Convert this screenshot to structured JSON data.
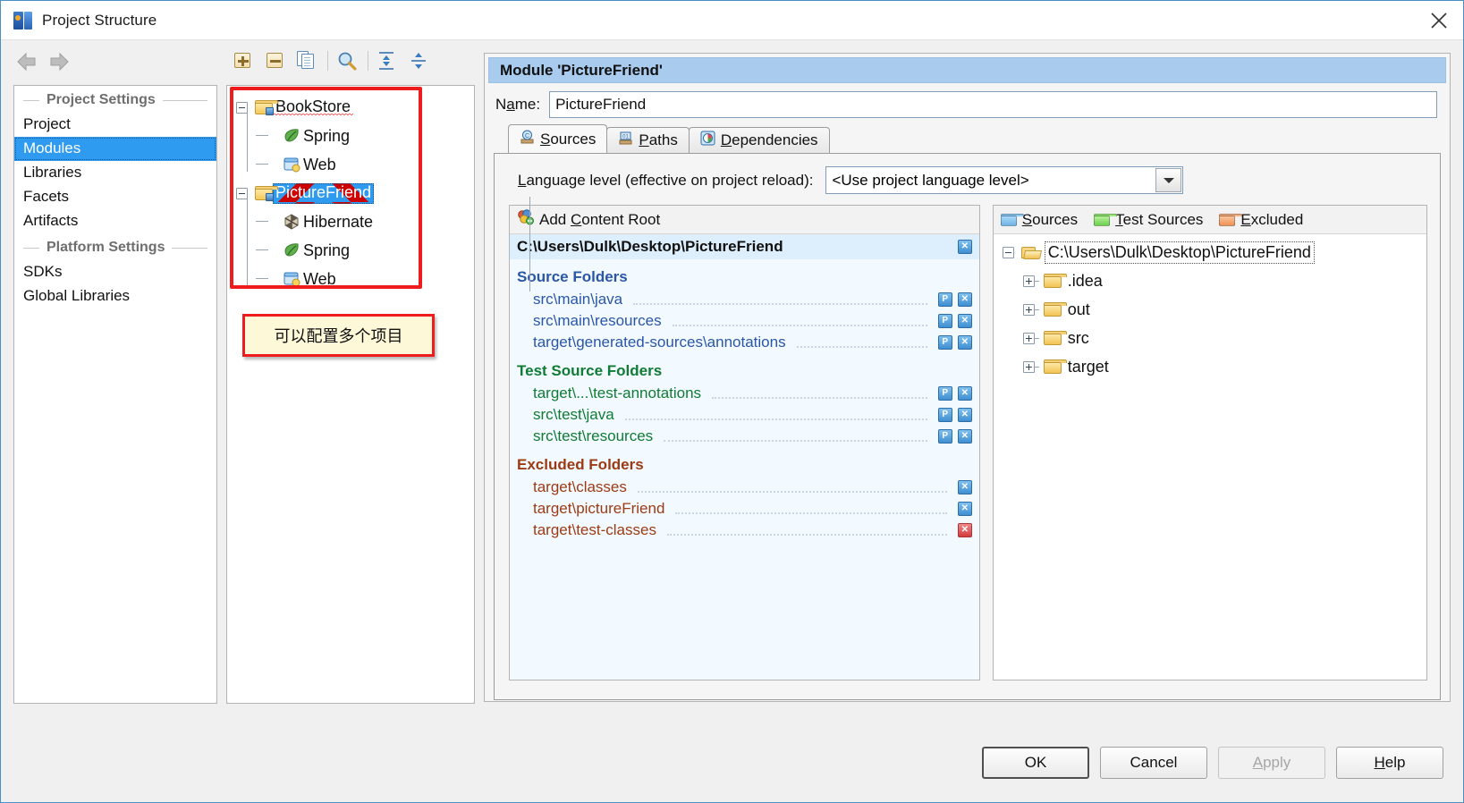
{
  "window": {
    "title": "Project Structure",
    "app_icon": "intellij-idea-icon",
    "close_icon": "close-icon"
  },
  "toolbar": {
    "back_icon": "arrow-left-icon",
    "forward_icon": "arrow-right-icon",
    "add_icon": "plus-icon",
    "remove_icon": "minus-icon",
    "copy_icon": "copy-icon",
    "find_icon": "search-icon",
    "expand_all_icon": "expand-all-icon",
    "collapse_all_icon": "collapse-all-icon"
  },
  "sidebar": {
    "groups": [
      {
        "title": "Project Settings",
        "items": [
          {
            "label": "Project",
            "selected": false
          },
          {
            "label": "Modules",
            "selected": true
          },
          {
            "label": "Libraries",
            "selected": false
          },
          {
            "label": "Facets",
            "selected": false
          },
          {
            "label": "Artifacts",
            "selected": false
          }
        ]
      },
      {
        "title": "Platform Settings",
        "items": [
          {
            "label": "SDKs",
            "selected": false
          },
          {
            "label": "Global Libraries",
            "selected": false
          }
        ]
      }
    ]
  },
  "module_tree": {
    "nodes": [
      {
        "label": "BookStore",
        "icon": "module-folder-icon",
        "level": 0,
        "expanded": true,
        "selected": false,
        "spellcheck": true
      },
      {
        "label": "Spring",
        "icon": "spring-leaf-icon",
        "level": 1,
        "selected": false
      },
      {
        "label": "Web",
        "icon": "web-facet-icon",
        "level": 1,
        "selected": false,
        "last": true
      },
      {
        "label": "PictureFriend",
        "icon": "module-folder-icon",
        "level": 0,
        "expanded": true,
        "selected": true,
        "spellcheck": true
      },
      {
        "label": "Hibernate",
        "icon": "hibernate-icon",
        "level": 1,
        "selected": false
      },
      {
        "label": "Spring",
        "icon": "spring-leaf-icon",
        "level": 1,
        "selected": false
      },
      {
        "label": "Web",
        "icon": "web-facet-icon",
        "level": 1,
        "selected": false,
        "last": true
      }
    ],
    "annotation": "可以配置多个项目",
    "highlight_color": "#ee1c1c"
  },
  "module_editor": {
    "header": "Module 'PictureFriend'",
    "name_label_pre": "N",
    "name_label_mn": "a",
    "name_label_post": "me:",
    "name_value": "PictureFriend",
    "tabs": [
      {
        "label": "Sources",
        "mnemonic": "S",
        "icon": "sources-tab-icon",
        "active": true
      },
      {
        "label": "Paths",
        "mnemonic": "P",
        "icon": "paths-tab-icon",
        "active": false
      },
      {
        "label": "Dependencies",
        "mnemonic": "D",
        "icon": "dependencies-tab-icon",
        "active": false
      }
    ],
    "language_level": {
      "label_mn": "L",
      "label_rest": "anguage level (effective on project reload):",
      "value": "<Use project language level>",
      "dropdown_icon": "chevron-down-icon"
    },
    "content_panel": {
      "add_content_root": {
        "pre": "Add ",
        "mn": "C",
        "post": "ontent Root",
        "icon": "add-content-root-icon"
      },
      "content_root_path": "C:\\Users\\Dulk\\Desktop\\PictureFriend",
      "content_root_remove_icon": "remove-content-root-icon",
      "sections": [
        {
          "title": "Source Folders",
          "kind": "source",
          "color": "#2a56a8",
          "rows": [
            {
              "path": "src\\main\\java",
              "buttons": [
                "P",
                "X"
              ]
            },
            {
              "path": "src\\main\\resources",
              "buttons": [
                "P",
                "X"
              ]
            },
            {
              "path": "target\\generated-sources\\annotations",
              "buttons": [
                "P",
                "X"
              ]
            }
          ]
        },
        {
          "title": "Test Source Folders",
          "kind": "test",
          "color": "#0f7b34",
          "rows": [
            {
              "path": "target\\...\\test-annotations",
              "buttons": [
                "P",
                "X"
              ]
            },
            {
              "path": "src\\test\\java",
              "buttons": [
                "P",
                "X"
              ]
            },
            {
              "path": "src\\test\\resources",
              "buttons": [
                "P",
                "X"
              ]
            }
          ]
        },
        {
          "title": "Excluded Folders",
          "kind": "excluded",
          "color": "#9b3a13",
          "rows": [
            {
              "path": "target\\classes",
              "buttons": [
                "X"
              ]
            },
            {
              "path": "target\\pictureFriend",
              "buttons": [
                "X"
              ]
            },
            {
              "path": "target\\test-classes",
              "buttons": [
                "X-red"
              ]
            }
          ]
        }
      ]
    },
    "fs_panel": {
      "mark_buttons": [
        {
          "label": "Sources",
          "mnemonic": "S",
          "icon": "sources-folder-icon",
          "color": "#6fb3e8"
        },
        {
          "label": "Test Sources",
          "mnemonic": "T",
          "icon": "test-sources-folder-icon",
          "color": "#7ed957"
        },
        {
          "label": "Excluded",
          "mnemonic": "E",
          "icon": "excluded-folder-icon",
          "color": "#f0955a"
        }
      ],
      "tree": [
        {
          "label": "C:\\Users\\Dulk\\Desktop\\PictureFriend",
          "level": 0,
          "expanded": true,
          "icon": "folder-open-icon",
          "selected": true
        },
        {
          "label": ".idea",
          "level": 1,
          "expanded": false,
          "icon": "folder-icon"
        },
        {
          "label": "out",
          "level": 1,
          "expanded": false,
          "icon": "folder-icon"
        },
        {
          "label": "src",
          "level": 1,
          "expanded": false,
          "icon": "folder-icon"
        },
        {
          "label": "target",
          "level": 1,
          "expanded": false,
          "icon": "folder-icon",
          "last": true
        }
      ]
    }
  },
  "footer": {
    "buttons": [
      {
        "label": "OK",
        "state": "default",
        "mnemonic": ""
      },
      {
        "label": "Cancel",
        "state": "normal",
        "mnemonic": ""
      },
      {
        "label": "Apply",
        "state": "disabled",
        "mnemonic": "A"
      },
      {
        "label": "Help",
        "state": "normal",
        "mnemonic": "H"
      }
    ]
  }
}
